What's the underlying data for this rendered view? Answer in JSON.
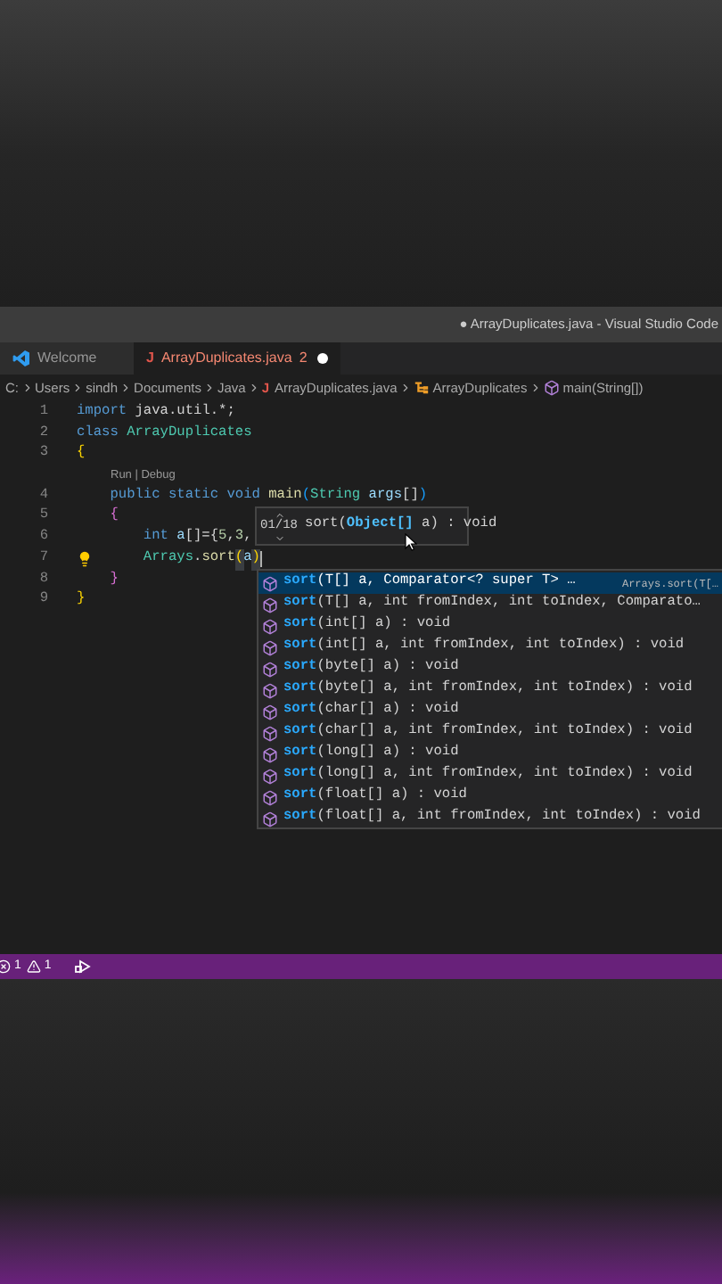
{
  "window": {
    "title": "● ArrayDuplicates.java - Visual Studio Code"
  },
  "tabs": [
    {
      "label": "Welcome",
      "kind": "welcome",
      "selected": false,
      "modified": false
    },
    {
      "label": "ArrayDuplicates.java",
      "icon_text": "J",
      "problems": "2",
      "kind": "java",
      "selected": true,
      "modified": true
    }
  ],
  "breadcrumb": [
    {
      "label": "C:",
      "kind": "folder"
    },
    {
      "label": "Users",
      "kind": "folder"
    },
    {
      "label": "sindh",
      "kind": "folder"
    },
    {
      "label": "Documents",
      "kind": "folder"
    },
    {
      "label": "Java",
      "kind": "folder"
    },
    {
      "label": "ArrayDuplicates.java",
      "kind": "file",
      "icon_text": "J"
    },
    {
      "label": "ArrayDuplicates",
      "kind": "class"
    },
    {
      "label": "main(String[])",
      "kind": "method"
    }
  ],
  "editor": {
    "lines": [
      {
        "kind": "code",
        "number": "1",
        "tokens": [
          {
            "text": "import",
            "kind": "keyword"
          },
          {
            "text": " java.util.*;",
            "kind": "plain"
          }
        ]
      },
      {
        "kind": "code",
        "number": "2",
        "tokens": [
          {
            "text": "class",
            "kind": "keyword"
          },
          {
            "text": " ArrayDuplicates",
            "kind": "type"
          }
        ]
      },
      {
        "kind": "code",
        "number": "3",
        "tokens": [
          {
            "text": "{",
            "kind": "brace1"
          }
        ]
      },
      {
        "kind": "codelens",
        "text": "Run | Debug"
      },
      {
        "kind": "code",
        "number": "4",
        "tokens": [
          {
            "text": "    public static void",
            "kind": "keyword"
          },
          {
            "text": " main",
            "kind": "function"
          },
          {
            "text": "(",
            "kind": "brace3"
          },
          {
            "text": "String",
            "kind": "type"
          },
          {
            "text": " args",
            "kind": "variable"
          },
          {
            "text": "[]",
            "kind": "plain"
          },
          {
            "text": ")",
            "kind": "brace3"
          }
        ]
      },
      {
        "kind": "code",
        "number": "5",
        "tokens": [
          {
            "text": "    {",
            "kind": "brace2"
          }
        ]
      },
      {
        "kind": "code",
        "number": "6",
        "tokens": [
          {
            "text": "        int",
            "kind": "keyword"
          },
          {
            "text": " a",
            "kind": "variable"
          },
          {
            "text": "[]={",
            "kind": "plain"
          },
          {
            "text": "5",
            "kind": "number"
          },
          {
            "text": ",",
            "kind": "plain"
          },
          {
            "text": "3",
            "kind": "number"
          },
          {
            "text": ",",
            "kind": "plain"
          }
        ]
      },
      {
        "kind": "code",
        "number": "7",
        "lightbulb": true,
        "caret": true,
        "tokens": [
          {
            "text": "        Arrays",
            "kind": "type"
          },
          {
            "text": ".",
            "kind": "plain"
          },
          {
            "text": "sort",
            "kind": "function"
          },
          {
            "text": "(",
            "kind": "match_bracket"
          },
          {
            "text": "a",
            "kind": "variable"
          },
          {
            "text": ")",
            "kind": "match_bracket"
          }
        ]
      },
      {
        "kind": "code",
        "number": "8",
        "tokens": [
          {
            "text": "    }",
            "kind": "brace2"
          }
        ]
      },
      {
        "kind": "code",
        "number": "9",
        "tokens": [
          {
            "text": "}",
            "kind": "brace1"
          }
        ]
      }
    ]
  },
  "parameter_hint": {
    "counter": "01/18",
    "before": "sort(",
    "active": "Object[]",
    "after": " a) : void"
  },
  "suggestions": [
    {
      "match": "sort",
      "rest": "(T[] a, Comparator<? super T> …",
      "detail": "Arrays.sort(T[…",
      "selected": true
    },
    {
      "match": "sort",
      "rest": "(T[] a, int fromIndex, int toIndex, Comparato…",
      "selected": false
    },
    {
      "match": "sort",
      "rest": "(int[] a) : void",
      "selected": false
    },
    {
      "match": "sort",
      "rest": "(int[] a, int fromIndex, int toIndex) : void",
      "selected": false
    },
    {
      "match": "sort",
      "rest": "(byte[] a) : void",
      "selected": false
    },
    {
      "match": "sort",
      "rest": "(byte[] a, int fromIndex, int toIndex) : void",
      "selected": false
    },
    {
      "match": "sort",
      "rest": "(char[] a) : void",
      "selected": false
    },
    {
      "match": "sort",
      "rest": "(char[] a, int fromIndex, int toIndex) : void",
      "selected": false
    },
    {
      "match": "sort",
      "rest": "(long[] a) : void",
      "selected": false
    },
    {
      "match": "sort",
      "rest": "(long[] a, int fromIndex, int toIndex) : void",
      "selected": false
    },
    {
      "match": "sort",
      "rest": "(float[] a) : void",
      "selected": false
    },
    {
      "match": "sort",
      "rest": "(float[] a, int fromIndex, int toIndex) : void",
      "selected": false
    }
  ],
  "status_bar": {
    "errors": "1",
    "warnings": "1"
  }
}
